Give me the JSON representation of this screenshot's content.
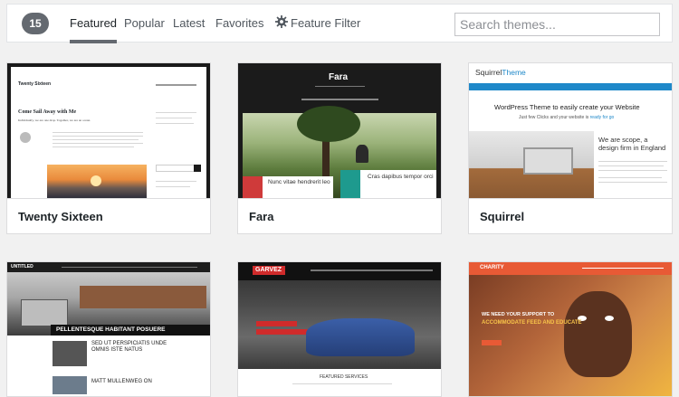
{
  "header": {
    "count": "15",
    "tabs": [
      {
        "label": "Featured"
      },
      {
        "label": "Popular"
      },
      {
        "label": "Latest"
      },
      {
        "label": "Favorites"
      }
    ],
    "feature_filter_label": "Feature Filter",
    "search_placeholder": "Search themes..."
  },
  "themes": [
    {
      "name": "Twenty Sixteen",
      "preview": {
        "site_title": "Twenty Sixteen",
        "post_title": "Come Sail Away with Me",
        "excerpt": "Individually, we are one drop. Together, we are an ocean."
      }
    },
    {
      "name": "Fara",
      "preview": {
        "site_title": "Fara",
        "caption_left": "Nunc vitae hendrerit leo",
        "caption_right": "Cras dapibus tempor orci"
      }
    },
    {
      "name": "Squirrel",
      "preview": {
        "logo_a": "Squirrel",
        "logo_b": "Theme",
        "headline": "WordPress Theme to easily create your Website",
        "subline_a": "Just few Clicks and your website is ",
        "subline_b": "ready for go",
        "side_text": "We are scope, a design firm in England"
      }
    },
    {
      "name": "",
      "preview": {
        "logo": "UNTITLED",
        "banner": "PELLENTESQUE HABITANT POSUERE",
        "item1": "SED UT PERSPICIATIS UNDE OMNIS ISTE NATUS",
        "item2": "MATT MULLENWEG ON"
      }
    },
    {
      "name": "",
      "preview": {
        "logo": "GARVEZ",
        "footer": "FEATURED SERVICES"
      }
    },
    {
      "name": "",
      "preview": {
        "logo": "CHARITY",
        "headline_a": "WE NEED YOUR SUPPORT TO",
        "headline_b": "ACCOMMODATE FEED AND EDUCATE"
      }
    }
  ],
  "colors": {
    "accent_fara": "#cf3a3a",
    "accent_squirrel": "#1e88c9",
    "accent_charity": "#e85a35",
    "count_badge": "#646970"
  }
}
